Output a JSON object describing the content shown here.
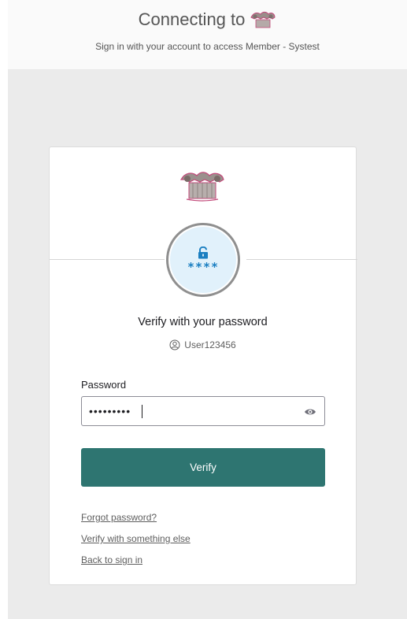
{
  "header": {
    "title": "Connecting to",
    "subtitle": "Sign in with your account to access Member - Systest",
    "logo_icon": "column-capital-logo"
  },
  "card": {
    "logo_icon": "column-capital-logo",
    "factor": {
      "icon": "padlock-icon",
      "text": "****"
    },
    "title": "Verify with your password",
    "username": "User123456",
    "password_label": "Password",
    "password_value": "•••••••••",
    "verify_label": "Verify",
    "links": {
      "forgot": "Forgot password?",
      "other": "Verify with something else",
      "back": "Back to sign in"
    }
  },
  "colors": {
    "primary_button": "#2e7571",
    "factor_bg": "#e1f1fb",
    "factor_fg": "#1b7fc1",
    "page_bg": "#ebebeb"
  }
}
